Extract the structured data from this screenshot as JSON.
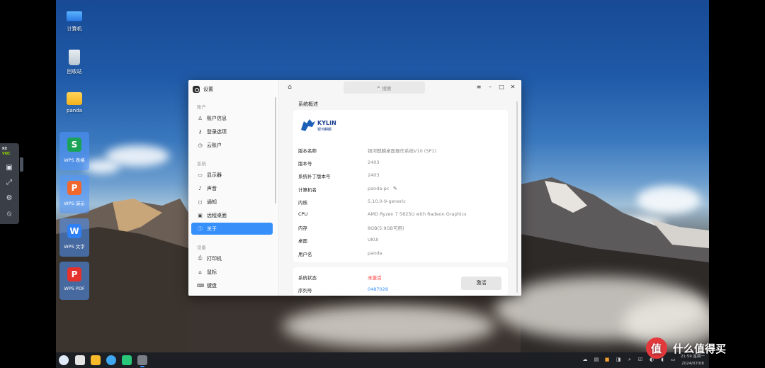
{
  "desktop": {
    "icons": [
      {
        "label": "计算机"
      },
      {
        "label": "回收站"
      },
      {
        "label": "panda"
      }
    ],
    "wps_tiles": [
      {
        "label": "WPS 表格",
        "glyph": "S",
        "color": "#1aa356"
      },
      {
        "label": "WPS 演示",
        "glyph": "P",
        "color": "#f0682e"
      },
      {
        "label": "WPS 文字",
        "glyph": "W",
        "color": "#2f7ff5"
      },
      {
        "label": "WPS PDF",
        "glyph": "P",
        "color": "#e5322d"
      }
    ]
  },
  "vnc": {
    "logo_top": "RE",
    "logo_bottom": "VNC"
  },
  "window": {
    "title": "设置",
    "search_placeholder": "搜索",
    "sidebar": {
      "sections": [
        {
          "label": "账户",
          "items": [
            {
              "label": "账户信息",
              "icon": "user-icon",
              "glyph": "♙"
            },
            {
              "label": "登录选项",
              "icon": "key-icon",
              "glyph": "⚷"
            },
            {
              "label": "云账户",
              "icon": "cloud-account-icon",
              "glyph": "◷"
            }
          ]
        },
        {
          "label": "系统",
          "items": [
            {
              "label": "显示器",
              "icon": "monitor-icon",
              "glyph": "▭"
            },
            {
              "label": "声音",
              "icon": "sound-icon",
              "glyph": "♪"
            },
            {
              "label": "通知",
              "icon": "notification-icon",
              "glyph": "◻"
            },
            {
              "label": "远程桌面",
              "icon": "remote-desktop-icon",
              "glyph": "▣"
            },
            {
              "label": "关于",
              "icon": "info-icon",
              "glyph": "ⓘ",
              "active": true
            }
          ]
        },
        {
          "label": "设备",
          "items": [
            {
              "label": "打印机",
              "icon": "printer-icon",
              "glyph": "⎙"
            },
            {
              "label": "鼠标",
              "icon": "mouse-icon",
              "glyph": "⌂"
            },
            {
              "label": "键盘",
              "icon": "keyboard-icon",
              "glyph": "⌨"
            }
          ]
        }
      ]
    },
    "main": {
      "title": "系统概述",
      "logo_text": "KYLIN",
      "logo_sub": "银河麒麟",
      "overview": [
        {
          "key": "版本名称",
          "value": "银河麒麟桌面操作系统V10 (SP1)"
        },
        {
          "key": "版本号",
          "value": "2403"
        },
        {
          "key": "系统补丁版本号",
          "value": "2403"
        },
        {
          "key": "计算机名",
          "value": "panda-pc"
        },
        {
          "key": "内核",
          "value": "5.10.0-9-generic"
        },
        {
          "key": "CPU",
          "value": "AMD Ryzen 7 5825U with Radeon Graphics"
        },
        {
          "key": "内存",
          "value": "8GB(5.9GB可用)"
        },
        {
          "key": "桌面",
          "value": "UKUI"
        },
        {
          "key": "用户名",
          "value": "panda"
        }
      ],
      "activation": {
        "status_key": "系统状态",
        "status_value": "未激活",
        "serial_key": "序列号",
        "serial_value": "0487028",
        "button": "激活"
      }
    }
  },
  "taskbar": {
    "clock_time": "21:59 星期一",
    "clock_date": "2024/07/08"
  },
  "watermark": {
    "text": "什么值得买"
  }
}
